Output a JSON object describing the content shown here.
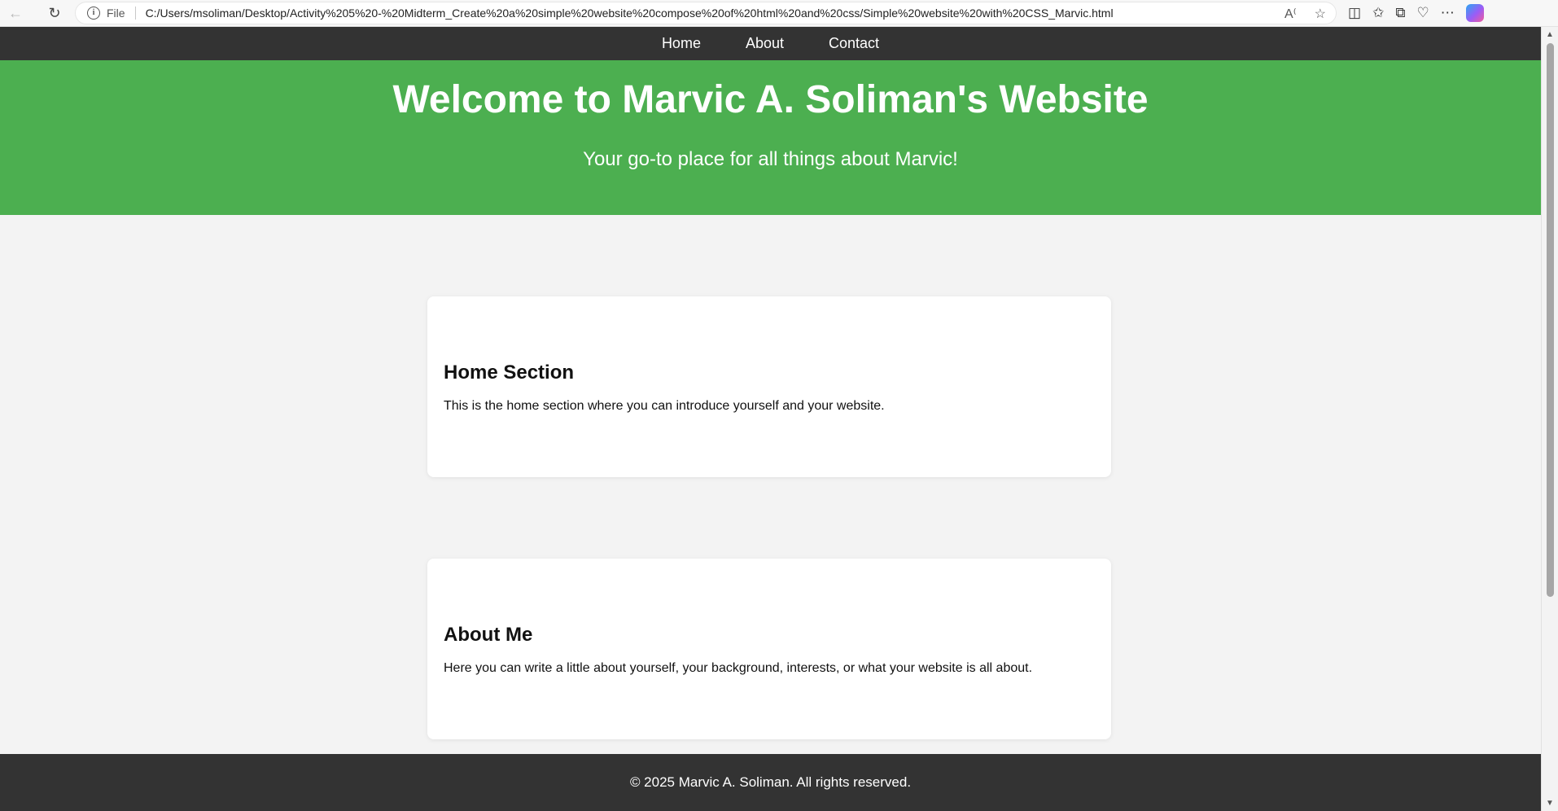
{
  "browser": {
    "file_label": "File",
    "url": "C:/Users/msoliman/Desktop/Activity%205%20-%20Midterm_Create%20a%20simple%20website%20compose%20of%20html%20and%20css/Simple%20website%20with%20CSS_Marvic.html",
    "icons": [
      "back-icon",
      "reload-icon",
      "info-icon",
      "read-aloud-icon",
      "favorite-star-icon",
      "split-screen-icon",
      "favorites-icon",
      "collections-icon",
      "browser-essentials-icon",
      "more-icon",
      "copilot-icon"
    ]
  },
  "nav": {
    "items": [
      "Home",
      "About",
      "Contact"
    ]
  },
  "hero": {
    "title": "Welcome to Marvic A. Soliman's Website",
    "subtitle": "Your go-to place for all things about Marvic!",
    "color": "#4caf50"
  },
  "sections": {
    "home": {
      "heading": "Home Section",
      "text": "This is the home section where you can introduce yourself and your website."
    },
    "about": {
      "heading": "About Me",
      "text": "Here you can write a little about yourself, your background, interests, or what your website is all about."
    }
  },
  "footer": {
    "text": "© 2025 Marvic A. Soliman. All rights reserved."
  },
  "colors": {
    "nav_bg": "#333333",
    "page_bg": "#f3f3f3"
  }
}
